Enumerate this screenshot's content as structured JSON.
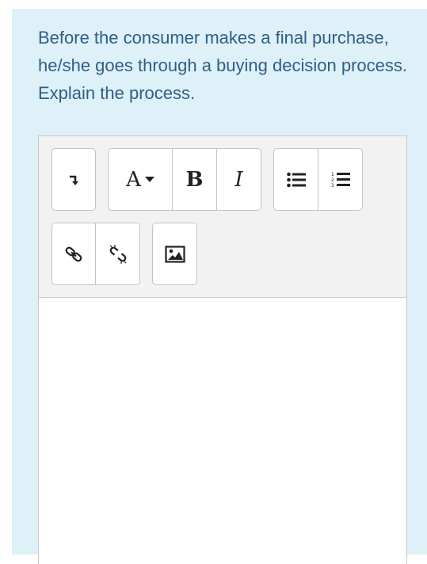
{
  "question": {
    "text": "Before the consumer makes a final purchase, he/she goes through a buying decision process. Explain the process."
  },
  "toolbar": {
    "font_button_label": "A",
    "bold_label": "B",
    "italic_label": "I"
  },
  "editor": {
    "value": ""
  },
  "colors": {
    "card_background": "#def0f8",
    "question_text": "#2f5e86",
    "toolbar_background": "#f2f2f2"
  },
  "icons": [
    "collapse-toolbar-icon",
    "font-style-icon",
    "bold-icon",
    "italic-icon",
    "bullet-list-icon",
    "numbered-list-icon",
    "link-icon",
    "unlink-icon",
    "image-icon"
  ]
}
